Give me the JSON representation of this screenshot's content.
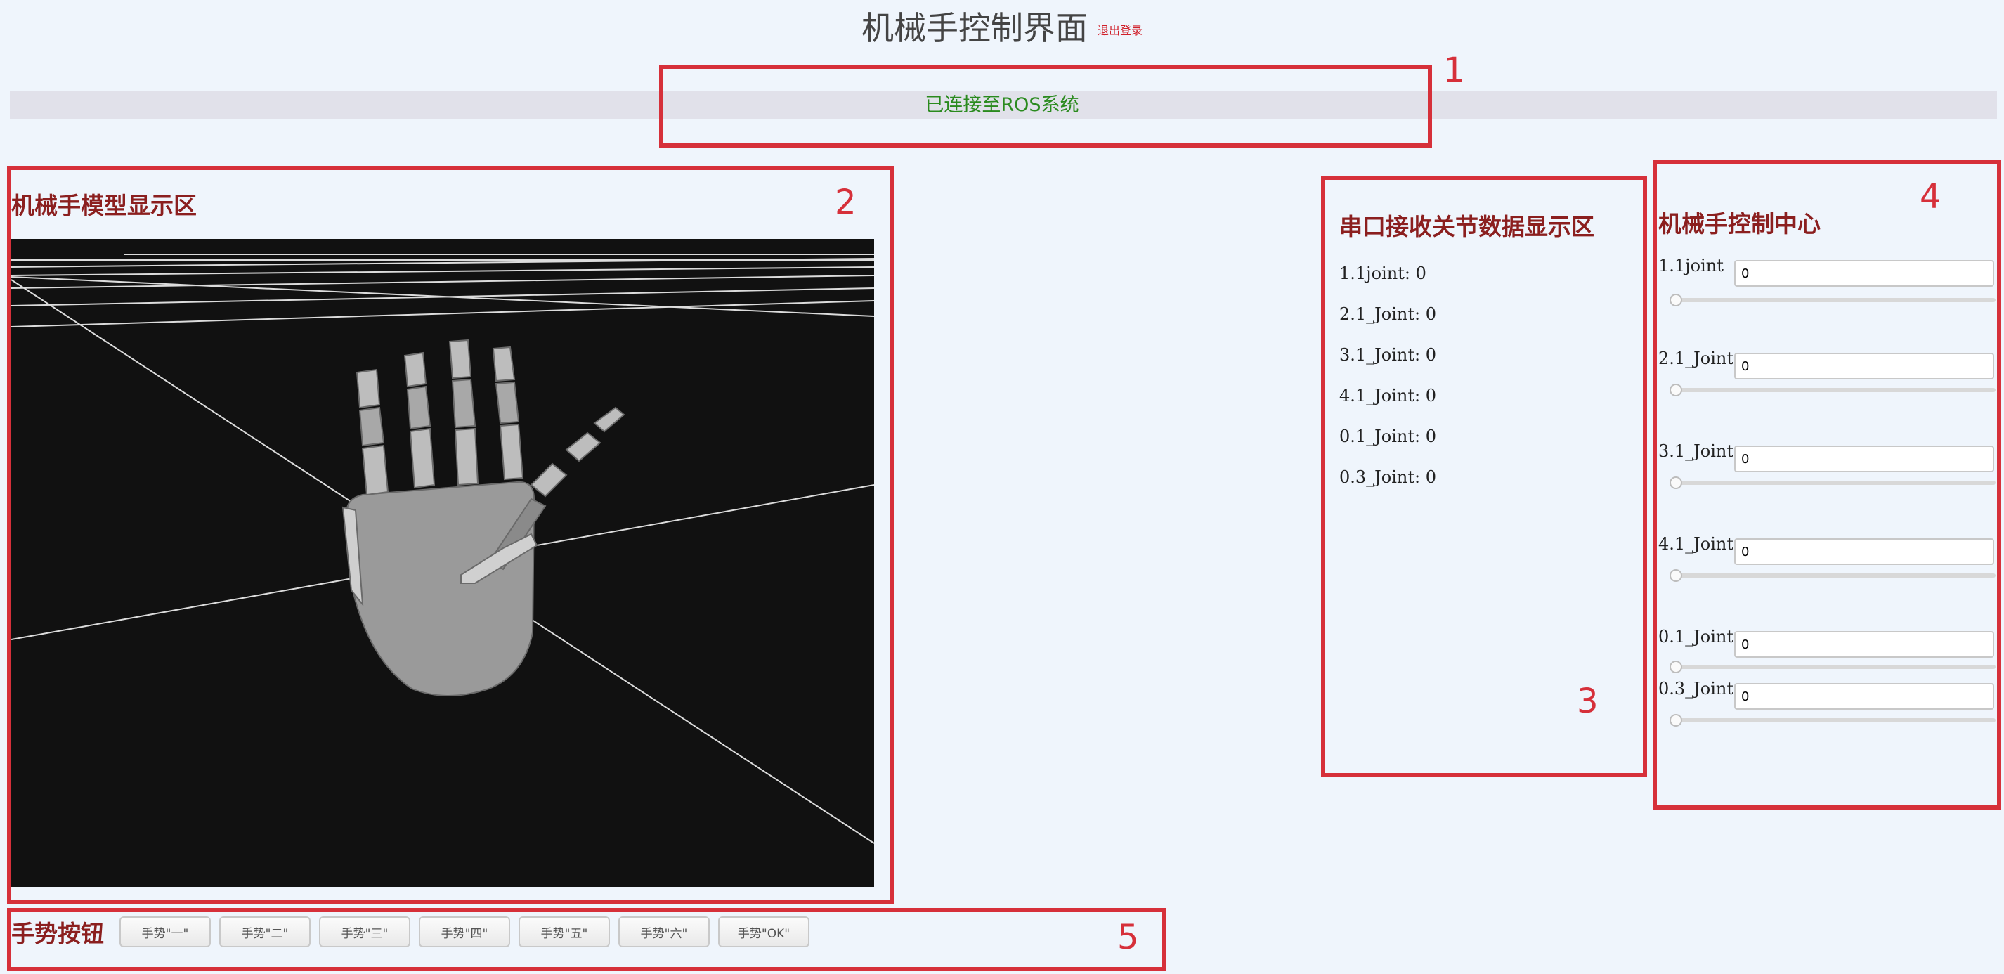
{
  "header": {
    "title": "机械手控制界面",
    "logout_label": "退出登录"
  },
  "status": {
    "text": "已连接至ROS系统"
  },
  "annotations": [
    "1",
    "2",
    "3",
    "4",
    "5"
  ],
  "model_panel": {
    "title": "机械手模型显示区"
  },
  "serial_panel": {
    "title": "串口接收关节数据显示区",
    "joints": [
      {
        "label": "1.1joint",
        "value": "0"
      },
      {
        "label": "2.1_Joint",
        "value": "0"
      },
      {
        "label": "3.1_Joint",
        "value": "0"
      },
      {
        "label": "4.1_Joint",
        "value": "0"
      },
      {
        "label": "0.1_Joint",
        "value": "0"
      },
      {
        "label": "0.3_Joint",
        "value": "0"
      }
    ]
  },
  "control_panel": {
    "title": "机械手控制中心",
    "joints": [
      {
        "label": "1.1joint",
        "value": "0",
        "slider_fraction": 0
      },
      {
        "label": "2.1_Joint",
        "value": "0",
        "slider_fraction": 0
      },
      {
        "label": "3.1_Joint",
        "value": "0",
        "slider_fraction": 0
      },
      {
        "label": "4.1_Joint",
        "value": "0",
        "slider_fraction": 0
      },
      {
        "label": "0.1_Joint",
        "value": "0",
        "slider_fraction": 0
      },
      {
        "label": "0.3_Joint",
        "value": "0",
        "slider_fraction": 0
      }
    ]
  },
  "gesture_panel": {
    "title": "手势按钮",
    "buttons": [
      "手势\"一\"",
      "手势\"二\"",
      "手势\"三\"",
      "手势\"四\"",
      "手势\"五\"",
      "手势\"六\"",
      "手势\"OK\""
    ]
  },
  "colors": {
    "annotation": "#d6303a",
    "section_title": "#8b1f1f",
    "status_text": "#2a8a1e",
    "viewer_background": "#111111"
  }
}
